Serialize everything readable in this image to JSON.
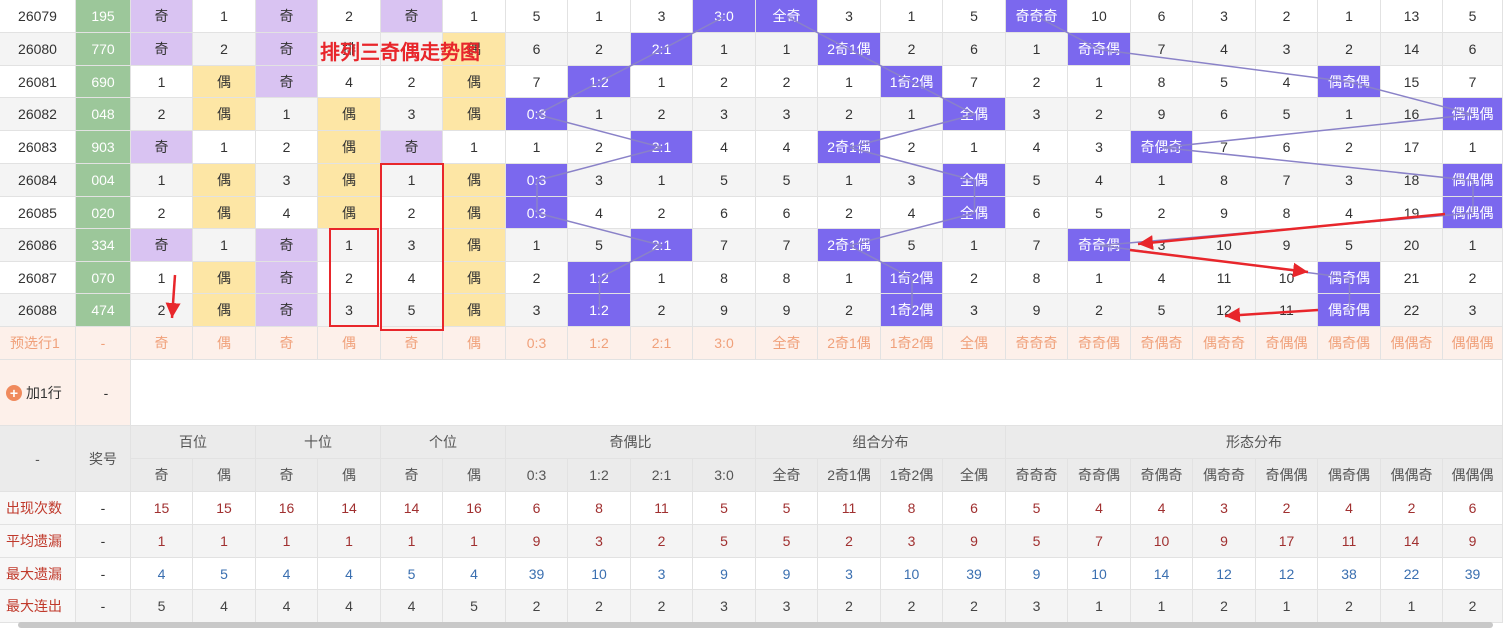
{
  "title": "排列三奇偶走势图",
  "add_row_label": "加1行",
  "add_row_value": "-",
  "rows": [
    {
      "issue": "26079",
      "number": "195",
      "bai": [
        "奇",
        "1"
      ],
      "shi": [
        "奇",
        "2"
      ],
      "ge": [
        "奇",
        "1"
      ],
      "ratio": [
        "5",
        "1",
        "3",
        "3:0"
      ],
      "combo": [
        "全奇",
        "3",
        "1",
        "5"
      ],
      "form": [
        "奇奇奇",
        "10",
        "6",
        "3",
        "2",
        "1",
        "13",
        "5"
      ]
    },
    {
      "issue": "26080",
      "number": "770",
      "bai": [
        "奇",
        "2"
      ],
      "shi": [
        "奇",
        "排"
      ],
      "ge": [
        "",
        "偶"
      ],
      "ratio": [
        "6",
        "2",
        "2:1",
        "1"
      ],
      "combo": [
        "1",
        "2奇1偶",
        "2",
        "6"
      ],
      "form": [
        "1",
        "奇奇偶",
        "7",
        "4",
        "3",
        "2",
        "14",
        "6"
      ]
    },
    {
      "issue": "26081",
      "number": "690",
      "bai": [
        "1",
        "偶"
      ],
      "shi": [
        "奇",
        "4"
      ],
      "ge": [
        "2",
        "偶"
      ],
      "ratio": [
        "7",
        "1:2",
        "1",
        "2"
      ],
      "combo": [
        "2",
        "1",
        "1奇2偶",
        "7"
      ],
      "form": [
        "2",
        "1",
        "8",
        "5",
        "4",
        "偶奇偶",
        "15",
        "7"
      ]
    },
    {
      "issue": "26082",
      "number": "048",
      "bai": [
        "2",
        "偶"
      ],
      "shi": [
        "1",
        "偶"
      ],
      "ge": [
        "3",
        "偶"
      ],
      "ratio": [
        "0:3",
        "1",
        "2",
        "3"
      ],
      "combo": [
        "3",
        "2",
        "1",
        "全偶"
      ],
      "form": [
        "3",
        "2",
        "9",
        "6",
        "5",
        "1",
        "16",
        "偶偶偶"
      ]
    },
    {
      "issue": "26083",
      "number": "903",
      "bai": [
        "奇",
        "1"
      ],
      "shi": [
        "2",
        "偶"
      ],
      "ge": [
        "奇",
        "1"
      ],
      "ratio": [
        "1",
        "2",
        "2:1",
        "4"
      ],
      "combo": [
        "4",
        "2奇1偶",
        "2",
        "1"
      ],
      "form": [
        "4",
        "3",
        "奇偶奇",
        "7",
        "6",
        "2",
        "17",
        "1"
      ]
    },
    {
      "issue": "26084",
      "number": "004",
      "bai": [
        "1",
        "偶"
      ],
      "shi": [
        "3",
        "偶"
      ],
      "ge": [
        "1",
        "偶"
      ],
      "ratio": [
        "0:3",
        "3",
        "1",
        "5"
      ],
      "combo": [
        "5",
        "1",
        "3",
        "全偶"
      ],
      "form": [
        "5",
        "4",
        "1",
        "8",
        "7",
        "3",
        "18",
        "偶偶偶"
      ]
    },
    {
      "issue": "26085",
      "number": "020",
      "bai": [
        "2",
        "偶"
      ],
      "shi": [
        "4",
        "偶"
      ],
      "ge": [
        "2",
        "偶"
      ],
      "ratio": [
        "0:3",
        "4",
        "2",
        "6"
      ],
      "combo": [
        "6",
        "2",
        "4",
        "全偶"
      ],
      "form": [
        "6",
        "5",
        "2",
        "9",
        "8",
        "4",
        "19",
        "偶偶偶"
      ]
    },
    {
      "issue": "26086",
      "number": "334",
      "bai": [
        "奇",
        "1"
      ],
      "shi": [
        "奇",
        "1"
      ],
      "ge": [
        "3",
        "偶"
      ],
      "ratio": [
        "1",
        "5",
        "2:1",
        "7"
      ],
      "combo": [
        "7",
        "2奇1偶",
        "5",
        "1"
      ],
      "form": [
        "7",
        "奇奇偶",
        "3",
        "10",
        "9",
        "5",
        "20",
        "1"
      ]
    },
    {
      "issue": "26087",
      "number": "070",
      "bai": [
        "1",
        "偶"
      ],
      "shi": [
        "奇",
        "2"
      ],
      "ge": [
        "4",
        "偶"
      ],
      "ratio": [
        "2",
        "1:2",
        "1",
        "8"
      ],
      "combo": [
        "8",
        "1",
        "1奇2偶",
        "2"
      ],
      "form": [
        "8",
        "1",
        "4",
        "11",
        "10",
        "偶奇偶",
        "21",
        "2"
      ]
    },
    {
      "issue": "26088",
      "number": "474",
      "bai": [
        "2",
        "偶"
      ],
      "shi": [
        "奇",
        "3"
      ],
      "ge": [
        "5",
        "偶"
      ],
      "ratio": [
        "3",
        "1:2",
        "2",
        "9"
      ],
      "combo": [
        "9",
        "2",
        "1奇2偶",
        "3"
      ],
      "form": [
        "9",
        "2",
        "5",
        "12",
        "11",
        "偶奇偶",
        "22",
        "3"
      ]
    }
  ],
  "preselect": {
    "label": "预选行1",
    "dash": "-",
    "cells": [
      "奇",
      "偶",
      "奇",
      "偶",
      "奇",
      "偶",
      "0:3",
      "1:2",
      "2:1",
      "3:0",
      "全奇",
      "2奇1偶",
      "1奇2偶",
      "全偶",
      "奇奇奇",
      "奇奇偶",
      "奇偶奇",
      "偶奇奇",
      "奇偶偶",
      "偶奇偶",
      "偶偶奇",
      "偶偶偶"
    ]
  },
  "header": {
    "dash": "-",
    "issue_label": "奖号",
    "groups": [
      "百位",
      "十位",
      "个位",
      "奇偶比",
      "组合分布",
      "形态分布"
    ],
    "sub": [
      "奇",
      "偶",
      "奇",
      "偶",
      "奇",
      "偶",
      "0:3",
      "1:2",
      "2:1",
      "3:0",
      "全奇",
      "2奇1偶",
      "1奇2偶",
      "全偶",
      "奇奇奇",
      "奇奇偶",
      "奇偶奇",
      "偶奇奇",
      "奇偶偶",
      "偶奇偶",
      "偶偶奇",
      "偶偶偶"
    ]
  },
  "stats": [
    {
      "label": "出现次数",
      "dash": "-",
      "values": [
        "15",
        "15",
        "16",
        "14",
        "14",
        "16",
        "6",
        "8",
        "11",
        "5",
        "5",
        "11",
        "8",
        "6",
        "5",
        "4",
        "4",
        "3",
        "2",
        "4",
        "2",
        "6"
      ]
    },
    {
      "label": "平均遗漏",
      "dash": "-",
      "values": [
        "1",
        "1",
        "1",
        "1",
        "1",
        "1",
        "9",
        "3",
        "2",
        "5",
        "5",
        "2",
        "3",
        "9",
        "5",
        "7",
        "10",
        "9",
        "17",
        "11",
        "14",
        "9"
      ]
    },
    {
      "label": "最大遗漏",
      "dash": "-",
      "values": [
        "4",
        "5",
        "4",
        "4",
        "5",
        "4",
        "39",
        "10",
        "3",
        "9",
        "9",
        "3",
        "10",
        "39",
        "9",
        "10",
        "14",
        "12",
        "12",
        "38",
        "22",
        "39"
      ]
    },
    {
      "label": "最大连出",
      "dash": "-",
      "values": [
        "5",
        "4",
        "4",
        "4",
        "4",
        "5",
        "2",
        "2",
        "2",
        "3",
        "3",
        "2",
        "2",
        "2",
        "3",
        "1",
        "1",
        "2",
        "1",
        "2",
        "1",
        "2"
      ]
    }
  ],
  "colors": {
    "odd": "#d9c3f2",
    "even": "#fde6a5",
    "number": "#9cc79a",
    "hit": "#7b68ee",
    "annotation": "#e8262b",
    "line": "#8a82c8"
  }
}
